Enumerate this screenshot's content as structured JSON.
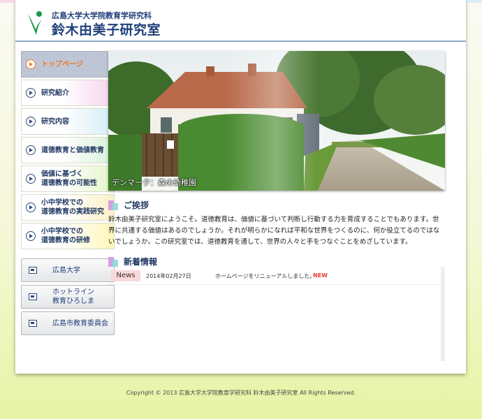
{
  "header": {
    "university": "広島大学大学院教育学研究科",
    "lab_name": "鈴木由美子研究室"
  },
  "sidebar": {
    "items": [
      {
        "label": "トップページ"
      },
      {
        "label": "研究紹介"
      },
      {
        "label": "研究内容"
      },
      {
        "label": "道徳教育と価値教育"
      },
      {
        "label_line1": "価値に基づく",
        "label_line2": "道徳教育の可能性"
      },
      {
        "label_line1": "小中学校での",
        "label_line2": "道徳教育の実践研究"
      },
      {
        "label_line1": "小中学校での",
        "label_line2": "道徳教育の研修"
      }
    ],
    "links": [
      {
        "label_line1": "広島大学"
      },
      {
        "label_line1": "ホットライン",
        "label_line2": "教育ひろしま"
      },
      {
        "label_line1": "広島市教育委員会"
      }
    ]
  },
  "hero": {
    "caption": "デンマーク：森の幼稚園"
  },
  "greeting": {
    "title": "ご挨拶",
    "text": "鈴木由美子研究室にようこそ。道徳教育は、価値に基づいて判断し行動する力を育成することでもあります。世界に共通する価値はあるのでしょうか。それが明らかになれば平和な世界をつくるのに、何か役立てるのではないでしょうか。この研究室では、道徳教育を通して、世界の人々と手をつなぐことをめざしています。"
  },
  "news": {
    "title": "新着情報",
    "items": [
      {
        "badge": "News",
        "date": "2014年02月27日",
        "text": "ホームページをリニューアルしました。",
        "flag": "NEW"
      }
    ]
  },
  "footer": {
    "copyright": "Copyright © 2013 広島大学大学院教育学研究科 鈴木由美子研究室 All Rights Reserved."
  },
  "colors": {
    "accent_orange": "#ee7c22",
    "navy": "#1f3763",
    "new_red": "#e63a3a"
  }
}
